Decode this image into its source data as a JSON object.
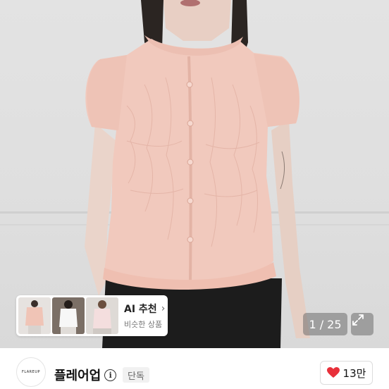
{
  "gallery": {
    "counter": "1 / 25",
    "expand_icon": "expand-icon"
  },
  "ai_recommend": {
    "title": "AI 추천",
    "subtitle": "비슷한 상품",
    "chevron": "›"
  },
  "shop": {
    "logo_text": "FLAREUP",
    "name": "플레어업",
    "tag": "단독",
    "likes": "13만",
    "heart_color": "#e8303a"
  }
}
